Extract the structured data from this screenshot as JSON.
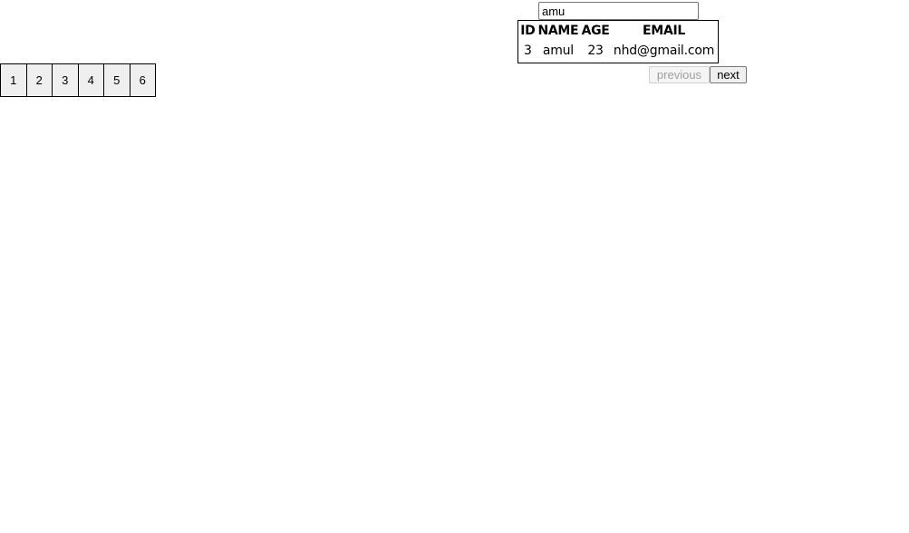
{
  "search": {
    "value": "amu"
  },
  "table": {
    "headers": [
      "ID",
      "NAME",
      "AGE",
      "EMAIL"
    ],
    "rows": [
      [
        "3",
        "amul",
        "23",
        "nhd@gmail.com"
      ]
    ]
  },
  "pagination": {
    "previous_label": "previous",
    "next_label": "next",
    "pages": [
      "1",
      "2",
      "3",
      "4",
      "5",
      "6"
    ]
  }
}
